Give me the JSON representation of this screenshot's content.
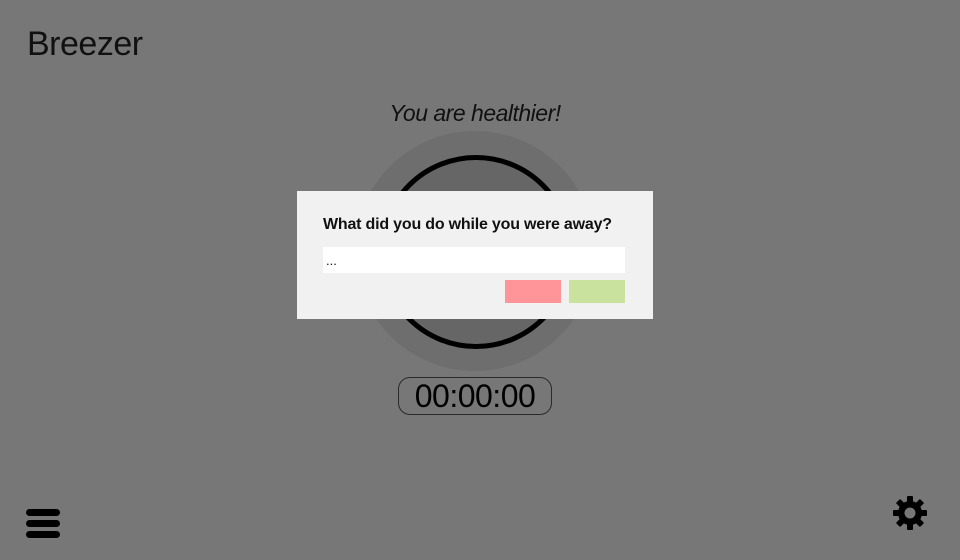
{
  "app": {
    "title": "Breezer"
  },
  "main": {
    "status_message": "You are healthier!",
    "timer": "00:00:00"
  },
  "dialog": {
    "prompt": "What did you do while you were away?",
    "input_value": "...",
    "cancel_color": "#ff9599",
    "confirm_color": "#c9e39e"
  },
  "icons": {
    "menu": "hamburger-menu-icon",
    "settings": "gear-icon"
  },
  "colors": {
    "background": "#777777",
    "dialog_background": "#f1f1f1"
  }
}
